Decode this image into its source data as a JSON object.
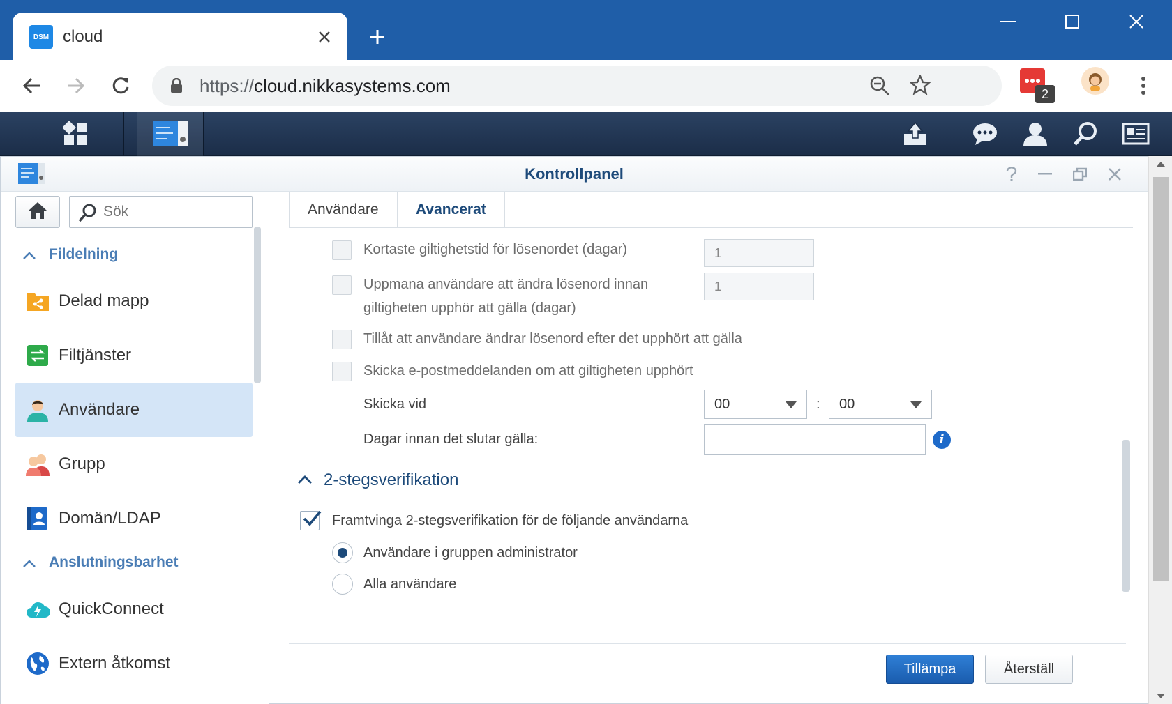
{
  "browser": {
    "tab_title": "cloud",
    "favicon_text": "DSM",
    "url_protocol": "https://",
    "url_host": "cloud.nikkasystems.com",
    "extension_badge": "2"
  },
  "window": {
    "title": "Kontrollpanel"
  },
  "sidebar": {
    "search_placeholder": "Sök",
    "section_1": "Fildelning",
    "section_2": "Anslutningsbarhet",
    "items": [
      {
        "label": "Delad mapp"
      },
      {
        "label": "Filtjänster"
      },
      {
        "label": "Användare"
      },
      {
        "label": "Grupp"
      },
      {
        "label": "Domän/LDAP"
      },
      {
        "label": "QuickConnect"
      },
      {
        "label": "Extern åtkomst"
      }
    ]
  },
  "tabs": {
    "users": "Användare",
    "advanced": "Avancerat"
  },
  "password": {
    "min_age_label": "Kortaste giltighetstid för lösenordet (dagar)",
    "min_age_value": "1",
    "remind_label_1": "Uppmana användare att ändra lösenord innan",
    "remind_label_2": "giltigheten upphör att gälla (dagar)",
    "remind_value": "1",
    "allow_change_label": "Tillåt att användare ändrar lösenord efter det upphört att gälla",
    "send_email_label": "Skicka e-postmeddelanden om att giltigheten upphört",
    "send_at_label": "Skicka vid",
    "hour": "00",
    "time_sep": ":",
    "minute": "00",
    "days_before_label": "Dagar innan det slutar gälla:",
    "info_icon_text": "i"
  },
  "two_step": {
    "title": "2-stegsverifikation",
    "enforce_label": "Framtvinga 2-stegsverifikation för de följande användarna",
    "option_admin": "Användare i gruppen administrator",
    "option_all": "Alla användare"
  },
  "buttons": {
    "apply": "Tillämpa",
    "reset": "Återställ"
  },
  "colors": {
    "chrome_blue": "#1f5ea8",
    "dsm_bar": "#1b2d48",
    "accent": "#1d4a7a",
    "selected_bg": "#d4e5f7"
  }
}
